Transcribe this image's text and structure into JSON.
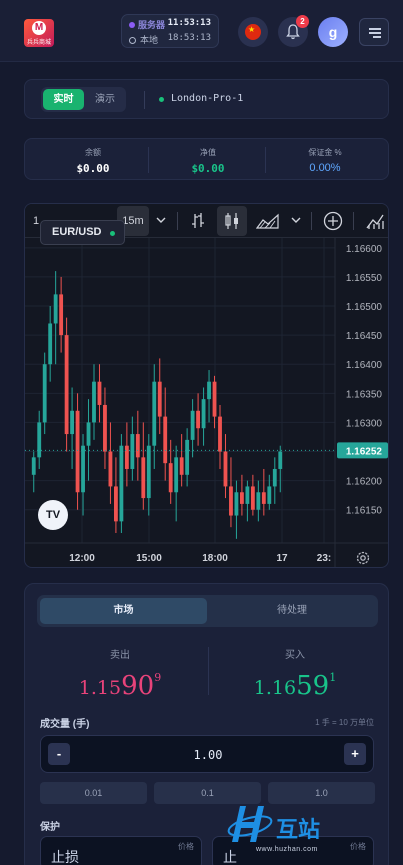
{
  "header": {
    "logo_text": "兵兵商城",
    "clock": {
      "server_label": "服务器",
      "server_time": "11:53:13",
      "local_label": "本地",
      "local_time": "18:53:13"
    },
    "notifications_count": "2",
    "avatar_letter": "g"
  },
  "account": {
    "mode_live": "实时",
    "mode_demo": "演示",
    "server_name": "London-Pro-1"
  },
  "balance": {
    "balance_label": "余额",
    "balance_value": "$0.00",
    "equity_label": "净值",
    "equity_value": "$0.00",
    "margin_label": "保证金 %",
    "margin_value": "0.00%"
  },
  "chart_toolbar": {
    "interval_1": "1",
    "interval_active": "15m"
  },
  "chart_data": {
    "type": "candlestick",
    "symbol": "EUR/USD",
    "last_price": "1.16252",
    "y_ticks": [
      "1.16600",
      "1.16550",
      "1.16500",
      "1.16450",
      "1.16400",
      "1.16350",
      "1.16300",
      "1.16250",
      "1.16200",
      "1.16150"
    ],
    "x_ticks": [
      "12:00",
      "15:00",
      "18:00",
      "17",
      "23:"
    ],
    "ylim": [
      1.1611,
      1.1661
    ],
    "candles": [
      [
        1.1621,
        1.1625,
        1.1618,
        1.1624
      ],
      [
        1.1624,
        1.1632,
        1.1622,
        1.163
      ],
      [
        1.163,
        1.1642,
        1.1628,
        1.164
      ],
      [
        1.164,
        1.165,
        1.1637,
        1.1647
      ],
      [
        1.1647,
        1.1656,
        1.164,
        1.1652
      ],
      [
        1.1652,
        1.1655,
        1.1642,
        1.1645
      ],
      [
        1.1645,
        1.1648,
        1.1625,
        1.1628
      ],
      [
        1.1628,
        1.1636,
        1.1622,
        1.1632
      ],
      [
        1.1632,
        1.1635,
        1.1615,
        1.1618
      ],
      [
        1.1618,
        1.1628,
        1.1614,
        1.1626
      ],
      [
        1.1626,
        1.1634,
        1.162,
        1.163
      ],
      [
        1.163,
        1.164,
        1.1627,
        1.1637
      ],
      [
        1.1637,
        1.164,
        1.163,
        1.1633
      ],
      [
        1.1633,
        1.1636,
        1.1622,
        1.1625
      ],
      [
        1.1625,
        1.163,
        1.1616,
        1.1619
      ],
      [
        1.1619,
        1.1624,
        1.1611,
        1.1613
      ],
      [
        1.1613,
        1.1628,
        1.1611,
        1.1626
      ],
      [
        1.1626,
        1.163,
        1.1619,
        1.1622
      ],
      [
        1.1622,
        1.1631,
        1.162,
        1.1628
      ],
      [
        1.1628,
        1.1632,
        1.162,
        1.1624
      ],
      [
        1.1624,
        1.163,
        1.1615,
        1.1617
      ],
      [
        1.1617,
        1.1628,
        1.1614,
        1.1626
      ],
      [
        1.1626,
        1.164,
        1.1622,
        1.1637
      ],
      [
        1.1637,
        1.1641,
        1.1628,
        1.1631
      ],
      [
        1.1631,
        1.1636,
        1.162,
        1.1623
      ],
      [
        1.1623,
        1.1627,
        1.1616,
        1.1618
      ],
      [
        1.1618,
        1.1626,
        1.1613,
        1.1624
      ],
      [
        1.1624,
        1.1628,
        1.1619,
        1.1621
      ],
      [
        1.1621,
        1.1629,
        1.1619,
        1.1627
      ],
      [
        1.1627,
        1.1634,
        1.1624,
        1.1632
      ],
      [
        1.1632,
        1.1635,
        1.1626,
        1.1629
      ],
      [
        1.1629,
        1.1636,
        1.1626,
        1.1634
      ],
      [
        1.1634,
        1.1639,
        1.163,
        1.1637
      ],
      [
        1.1637,
        1.1638,
        1.1629,
        1.1631
      ],
      [
        1.1631,
        1.1633,
        1.1622,
        1.1625
      ],
      [
        1.1625,
        1.1628,
        1.1617,
        1.1619
      ],
      [
        1.1619,
        1.1624,
        1.1612,
        1.1614
      ],
      [
        1.1614,
        1.162,
        1.161,
        1.1618
      ],
      [
        1.1618,
        1.1621,
        1.1614,
        1.1616
      ],
      [
        1.1616,
        1.162,
        1.1613,
        1.1619
      ],
      [
        1.1619,
        1.1621,
        1.1614,
        1.1615
      ],
      [
        1.1615,
        1.162,
        1.1613,
        1.1618
      ],
      [
        1.1618,
        1.1622,
        1.1614,
        1.1616
      ],
      [
        1.1616,
        1.1621,
        1.1615,
        1.1619
      ],
      [
        1.1619,
        1.1624,
        1.1616,
        1.1622
      ],
      [
        1.1622,
        1.1626,
        1.1618,
        1.1625
      ]
    ]
  },
  "order": {
    "tab_market": "市场",
    "tab_pending": "待处理",
    "sell_label": "卖出",
    "sell_price": {
      "small": "1.15",
      "big": "90",
      "sup": "9"
    },
    "buy_label": "买入",
    "buy_price": {
      "small": "1.16",
      "big": "59",
      "sup": "1"
    },
    "volume_label": "成交量 (手)",
    "volume_hint": "1 手 = 10 万单位",
    "volume_value": "1.00",
    "minus": "-",
    "plus": "+",
    "quick": [
      "0.01",
      "0.1",
      "1.0"
    ],
    "protection_label": "保护",
    "stop_loss": "止损",
    "take_profit": "止",
    "price_hint": "价格"
  },
  "watermark": {
    "text": "互站",
    "url": "www.huzhan.com"
  },
  "colors": {
    "buy": "#19c48a",
    "sell": "#e8437a",
    "accent": "#19b36f"
  }
}
